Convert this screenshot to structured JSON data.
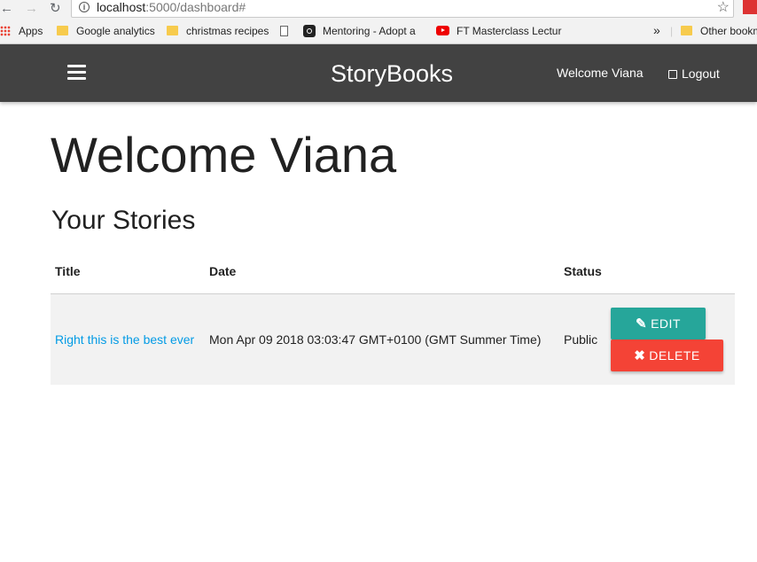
{
  "browser": {
    "url_host": "localhost",
    "url_rest": ":5000/dashboard#",
    "bookmarks": [
      {
        "label": "Apps"
      },
      {
        "label": "Google analytics"
      },
      {
        "label": "christmas recipes"
      },
      {
        "label": ""
      },
      {
        "label": "Mentoring - Adopt a"
      },
      {
        "label": "FT Masterclass Lectur"
      },
      {
        "label": "»"
      },
      {
        "label": "Other bookm"
      }
    ]
  },
  "navbar": {
    "brand": "StoryBooks",
    "welcome": "Welcome Viana",
    "logout": "Logout"
  },
  "page": {
    "heading": "Welcome Viana",
    "subheading": "Your Stories"
  },
  "table": {
    "headers": [
      "Title",
      "Date",
      "Status"
    ],
    "rows": [
      {
        "title": "Right this is the best ever",
        "date": "Mon Apr 09 2018 03:03:47 GMT+0100 (GMT Summer Time)",
        "status": "Public",
        "edit_label": "Edit",
        "delete_label": "Delete"
      }
    ]
  },
  "colors": {
    "navbar": "#424242",
    "edit": "#26a69a",
    "delete": "#f44336",
    "link": "#039be5"
  }
}
